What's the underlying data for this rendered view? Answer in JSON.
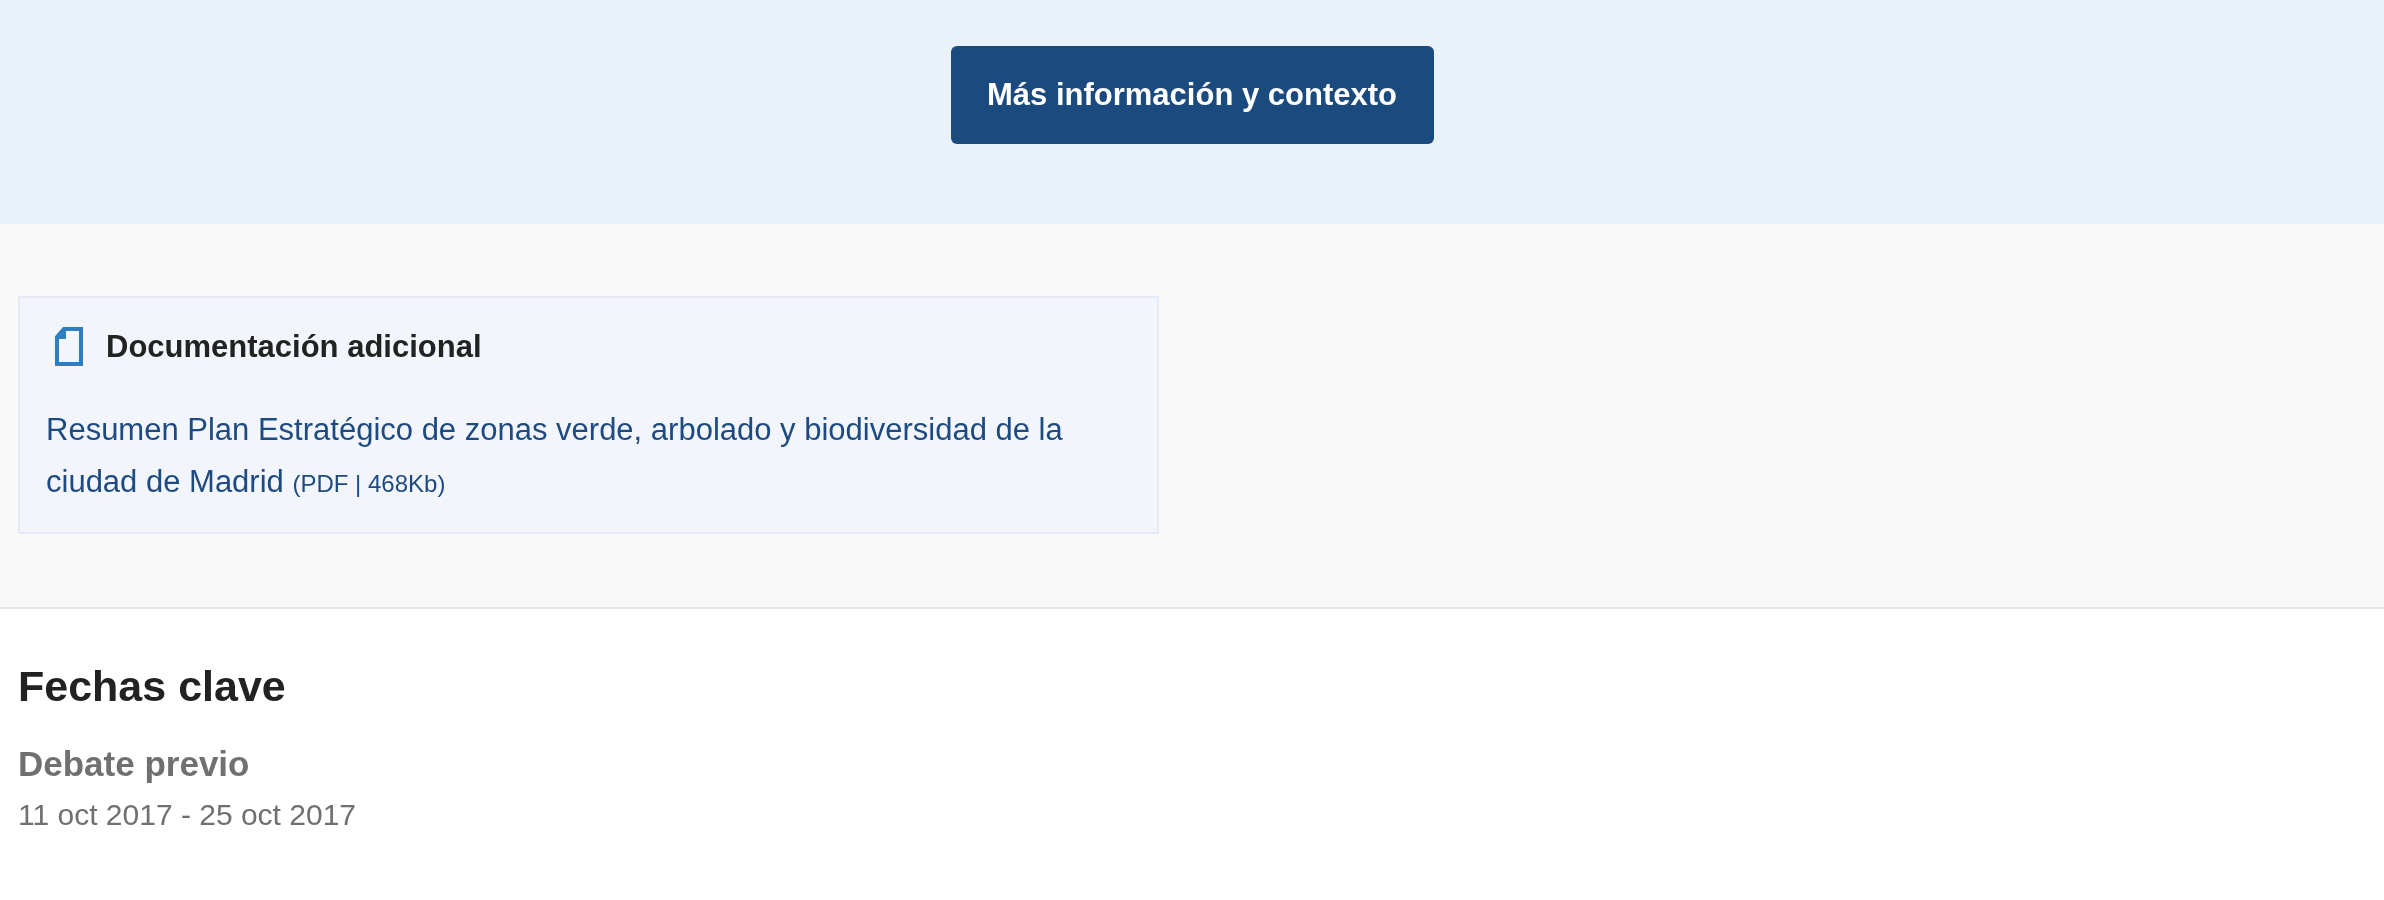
{
  "more_info_button": {
    "label": "Más información y contexto"
  },
  "documentation": {
    "title": "Documentación adicional",
    "links": [
      {
        "text": "Resumen Plan Estratégico de zonas verde, arbolado y biodiversidad de la ciudad de Madrid",
        "meta": "(PDF | 468Kb)"
      }
    ]
  },
  "key_dates": {
    "title": "Fechas clave",
    "items": [
      {
        "phase": "Debate previo",
        "dates": "11 oct 2017 - 25 oct 2017"
      }
    ]
  }
}
